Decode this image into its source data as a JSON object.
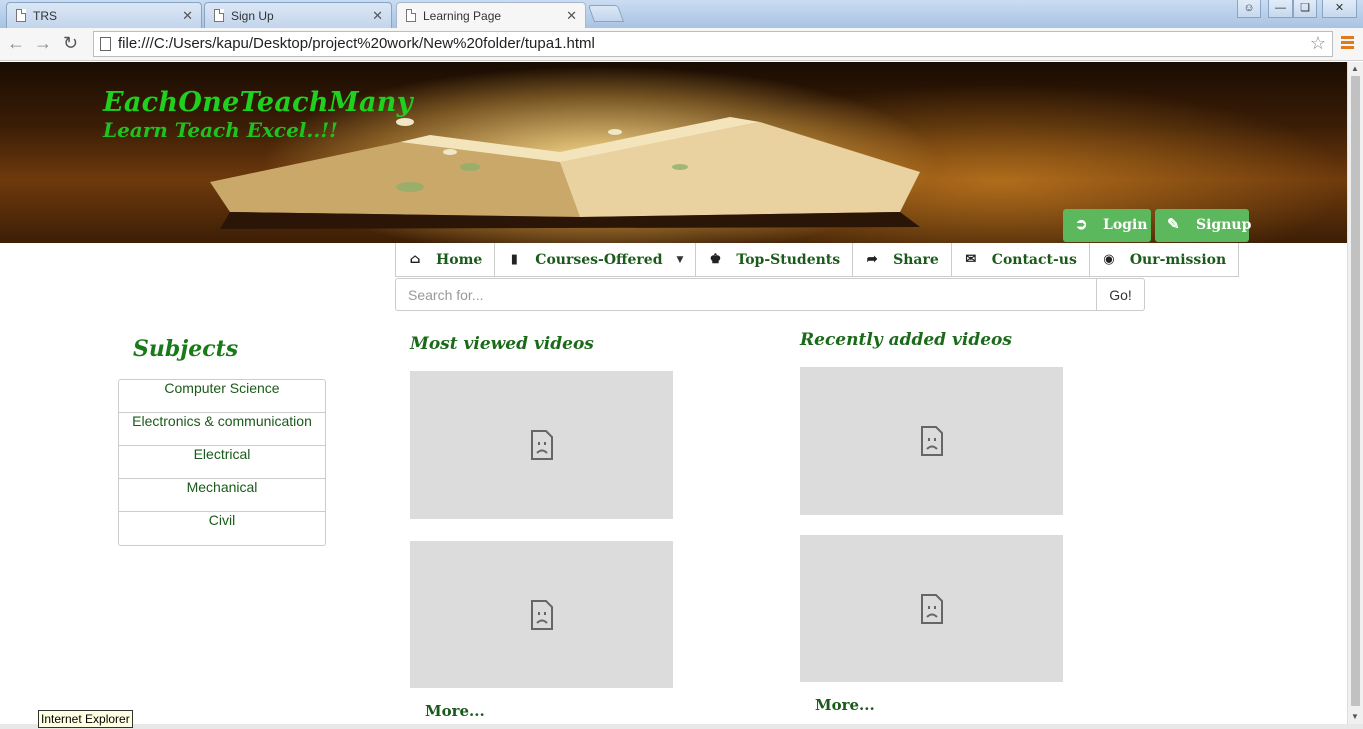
{
  "browser": {
    "tabs": [
      {
        "title": "TRS",
        "active": false
      },
      {
        "title": "Sign Up",
        "active": false
      },
      {
        "title": "Learning Page",
        "active": true
      }
    ],
    "address": "file:///C:/Users/kapu/Desktop/project%20work/New%20folder/tupa1.html",
    "tooltip": "Internet Explorer"
  },
  "header": {
    "brand": "EachOneTeachMany",
    "tagline": "Learn Teach Excel..!!",
    "login_label": "Login",
    "signup_label": "Signup"
  },
  "nav": {
    "items": [
      {
        "label": "Home",
        "icon": "home-icon"
      },
      {
        "label": "Courses-Offered",
        "icon": "book-icon",
        "dropdown": true
      },
      {
        "label": "Top-Students",
        "icon": "chess-king-icon"
      },
      {
        "label": "Share",
        "icon": "share-icon"
      },
      {
        "label": "Contact-us",
        "icon": "envelope-icon"
      },
      {
        "label": "Our-mission",
        "icon": "target-icon"
      }
    ]
  },
  "search": {
    "placeholder": "Search for...",
    "button_label": "Go!"
  },
  "subjects": {
    "title": "Subjects",
    "items": [
      "Computer Science",
      "Electronics & communication",
      "Electrical",
      "Mechanical",
      "Civil"
    ]
  },
  "most_viewed": {
    "title": "Most viewed videos",
    "more_label": "More..."
  },
  "recently_added": {
    "title": "Recently added videos",
    "more_label": "More..."
  },
  "colors": {
    "brand_green": "#1fd01f",
    "link_green": "#1a5a1a",
    "button_green": "#5cb85c"
  }
}
